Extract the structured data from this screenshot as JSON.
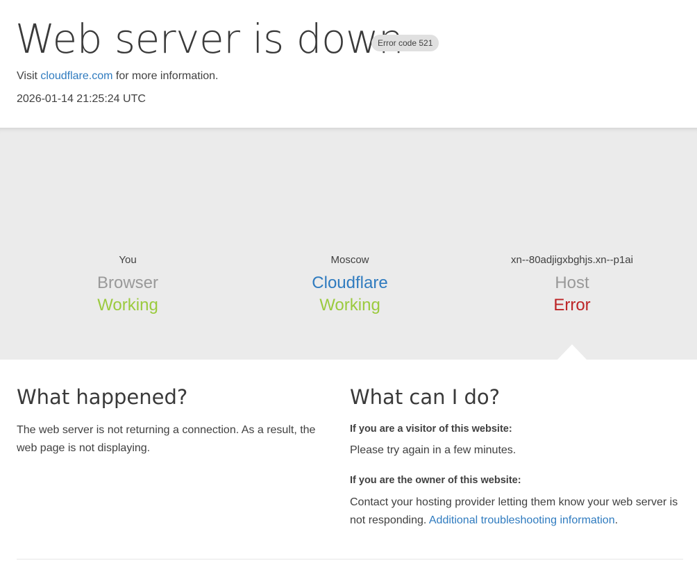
{
  "header": {
    "title": "Web server is down",
    "error_badge": "Error code 521",
    "visit_prefix": "Visit",
    "visit_link": "cloudflare.com",
    "visit_suffix": "for more information.",
    "timestamp": "2026-01-14 21:25:24 UTC"
  },
  "status": {
    "nodes": [
      {
        "location": "You",
        "kind": "Browser",
        "state": "Working",
        "state_type": "ok"
      },
      {
        "location": "Moscow",
        "kind": "Cloudflare",
        "state": "Working",
        "state_type": "ok"
      },
      {
        "location": "xn--80adjigxbghjs.xn--p1ai",
        "kind": "Host",
        "state": "Error",
        "state_type": "error"
      }
    ],
    "colors": {
      "working": "#9bca3e",
      "error": "#bd2426",
      "link": "#2f7bbf",
      "band": "#ebebeb"
    }
  },
  "what_happened": {
    "heading": "What happened?",
    "body": "The web server is not returning a connection. As a result, the web page is not displaying."
  },
  "what_can_i_do": {
    "heading": "What can I do?",
    "visitor_label": "If you are a visitor of this website:",
    "visitor_text": "Please try again in a few minutes.",
    "owner_label": "If you are the owner of this website:",
    "owner_text": "Contact your hosting provider letting them know your web server is not responding.",
    "owner_link": "Additional troubleshooting information",
    "owner_link_suffix": "."
  }
}
